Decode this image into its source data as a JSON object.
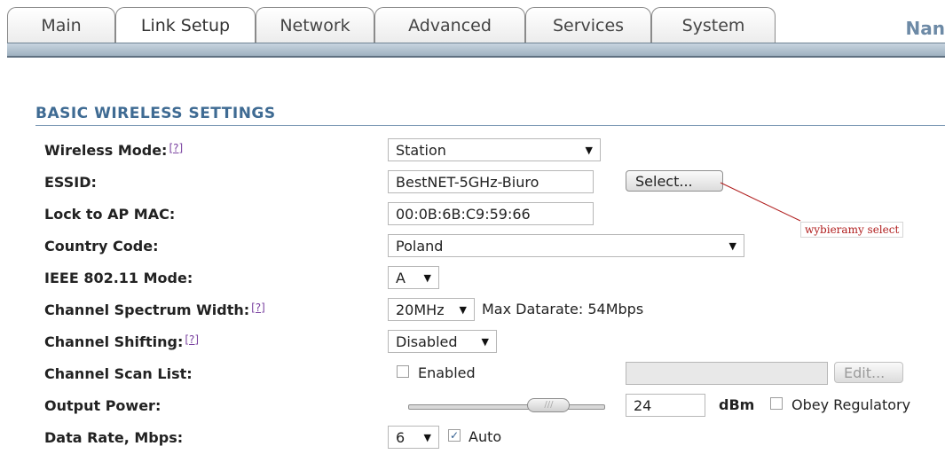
{
  "tabs": [
    {
      "label": "Main"
    },
    {
      "label": "Link Setup"
    },
    {
      "label": "Network"
    },
    {
      "label": "Advanced"
    },
    {
      "label": "Services"
    },
    {
      "label": "System"
    }
  ],
  "brand": "Nan",
  "section": {
    "title": "BASIC WIRELESS SETTINGS"
  },
  "help_link": "[?]",
  "rows": {
    "wireless_mode": {
      "label": "Wireless Mode:",
      "value": "Station"
    },
    "essid": {
      "label": "ESSID:",
      "value": "BestNET-5GHz-Biuro",
      "button": "Select..."
    },
    "lock_ap": {
      "label": "Lock to AP MAC:",
      "value": "00:0B:6B:C9:59:66"
    },
    "country": {
      "label": "Country Code:",
      "value": "Poland"
    },
    "ieee": {
      "label": "IEEE 802.11 Mode:",
      "value": "A"
    },
    "spectrum": {
      "label": "Channel Spectrum Width:",
      "value": "20MHz",
      "extra": "Max Datarate: 54Mbps"
    },
    "shifting": {
      "label": "Channel Shifting:",
      "value": "Disabled"
    },
    "scan_list": {
      "label": "Channel Scan List:",
      "checkbox": "Enabled",
      "button": "Edit..."
    },
    "output_power": {
      "label": "Output Power:",
      "value": "24",
      "unit": "dBm",
      "checkbox": "Obey Regulatory",
      "level": 0.72
    },
    "data_rate": {
      "label": "Data Rate, Mbps:",
      "value": "6",
      "checkbox": "Auto"
    }
  },
  "annotation": {
    "text": "wybieramy select"
  },
  "colors": {
    "accent": "#3f6b93",
    "annotation": "#b01d1d"
  }
}
